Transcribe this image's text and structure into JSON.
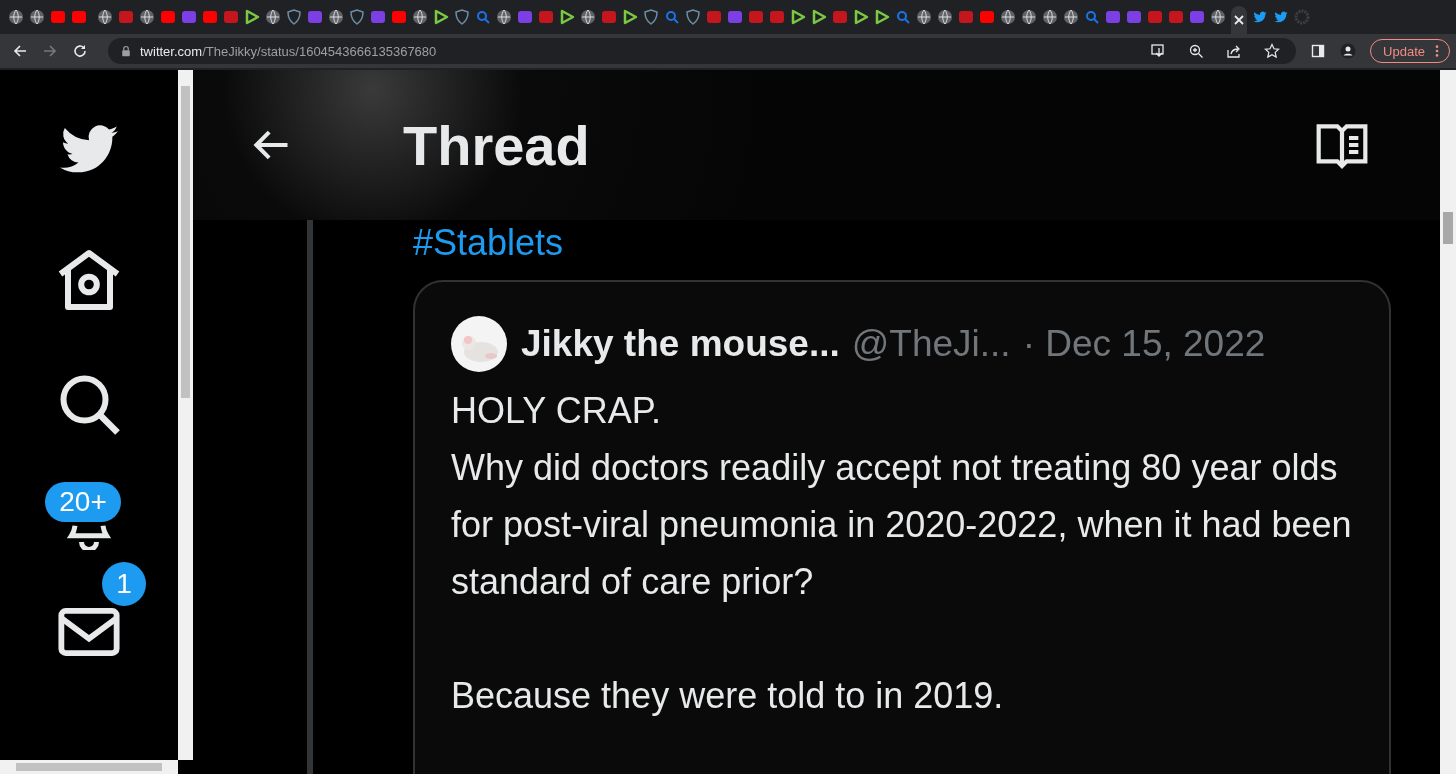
{
  "browser": {
    "address": {
      "host": "twitter.com",
      "path": "/TheJikky/status/1604543666135367680"
    },
    "update_button": "Update"
  },
  "sidebar": {
    "notifications_badge": "20+",
    "messages_badge": "1"
  },
  "header": {
    "title": "Thread"
  },
  "thread": {
    "hashtag": "#Stablets",
    "quote": {
      "name": "Jikky the mouse...",
      "handle": "@TheJi...",
      "date": "· Dec 15, 2022",
      "text": "HOLY CRAP.\nWhy did doctors readily accept not treating 80 year olds for post-viral pneumonia in 2020-2022, when it had been standard of care prior?\n\nBecause they were told to in 2019."
    }
  }
}
